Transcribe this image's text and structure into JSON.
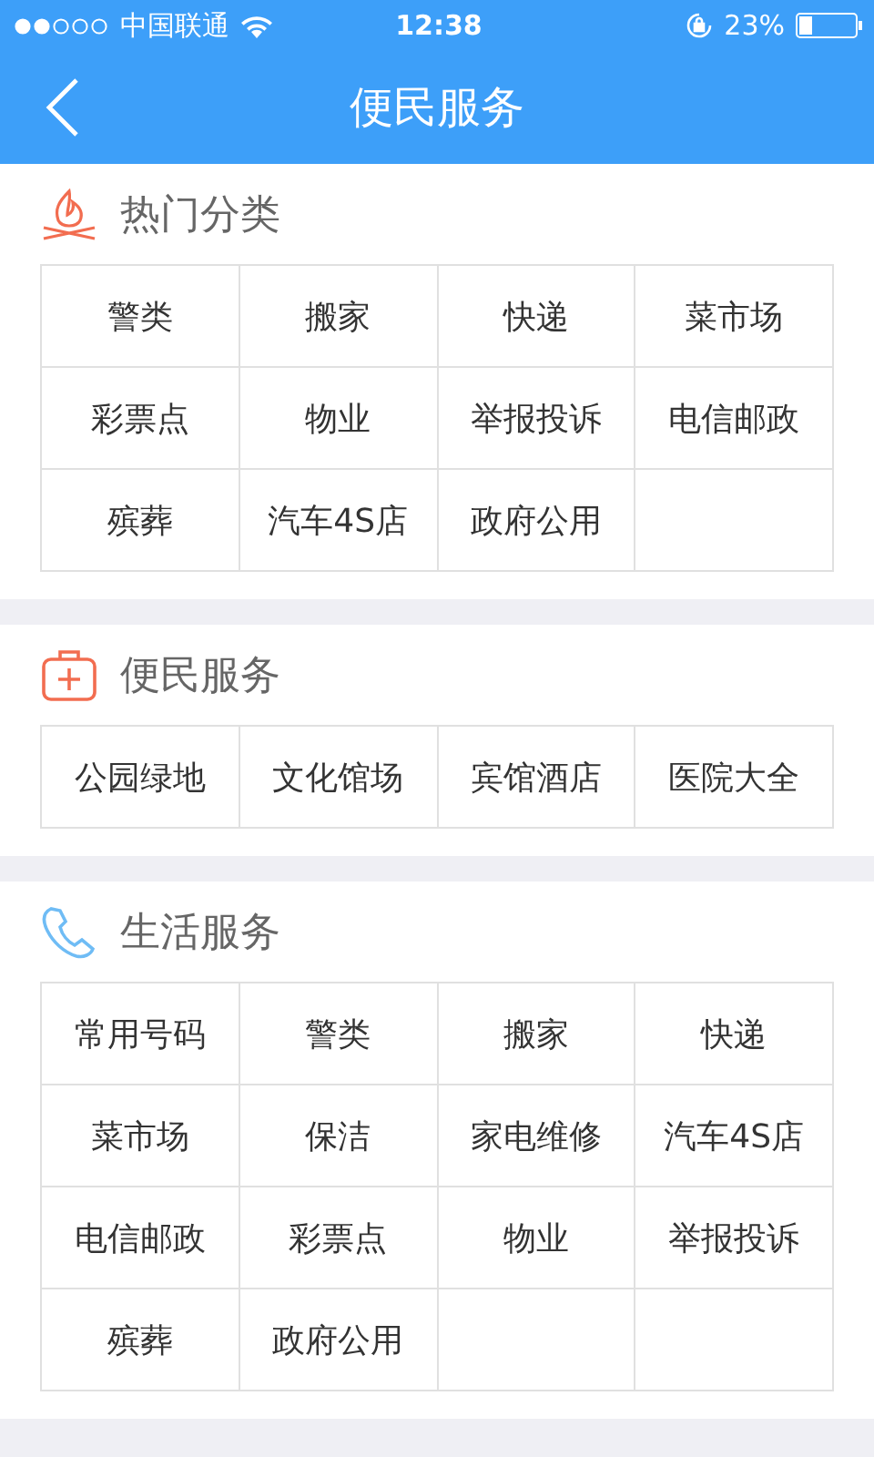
{
  "status_bar": {
    "carrier": "中国联通",
    "time": "12:38",
    "battery": "23%"
  },
  "nav_bar": {
    "title": "便民服务"
  },
  "sections": [
    {
      "kind": "fire",
      "title": "热门分类",
      "items": [
        "警类",
        "搬家",
        "快递",
        "菜市场",
        "彩票点",
        "物业",
        "举报投诉",
        "电信邮政",
        "殡葬",
        "汽车4S店",
        "政府公用"
      ]
    },
    {
      "kind": "medkit",
      "title": "便民服务",
      "items": [
        "公园绿地",
        "文化馆场",
        "宾馆酒店",
        "医院大全"
      ]
    },
    {
      "kind": "phone",
      "title": "生活服务",
      "items": [
        "常用号码",
        "警类",
        "搬家",
        "快递",
        "菜市场",
        "保洁",
        "家电维修",
        "汽车4S店",
        "电信邮政",
        "彩票点",
        "物业",
        "举报投诉",
        "殡葬",
        "政府公用"
      ]
    }
  ]
}
